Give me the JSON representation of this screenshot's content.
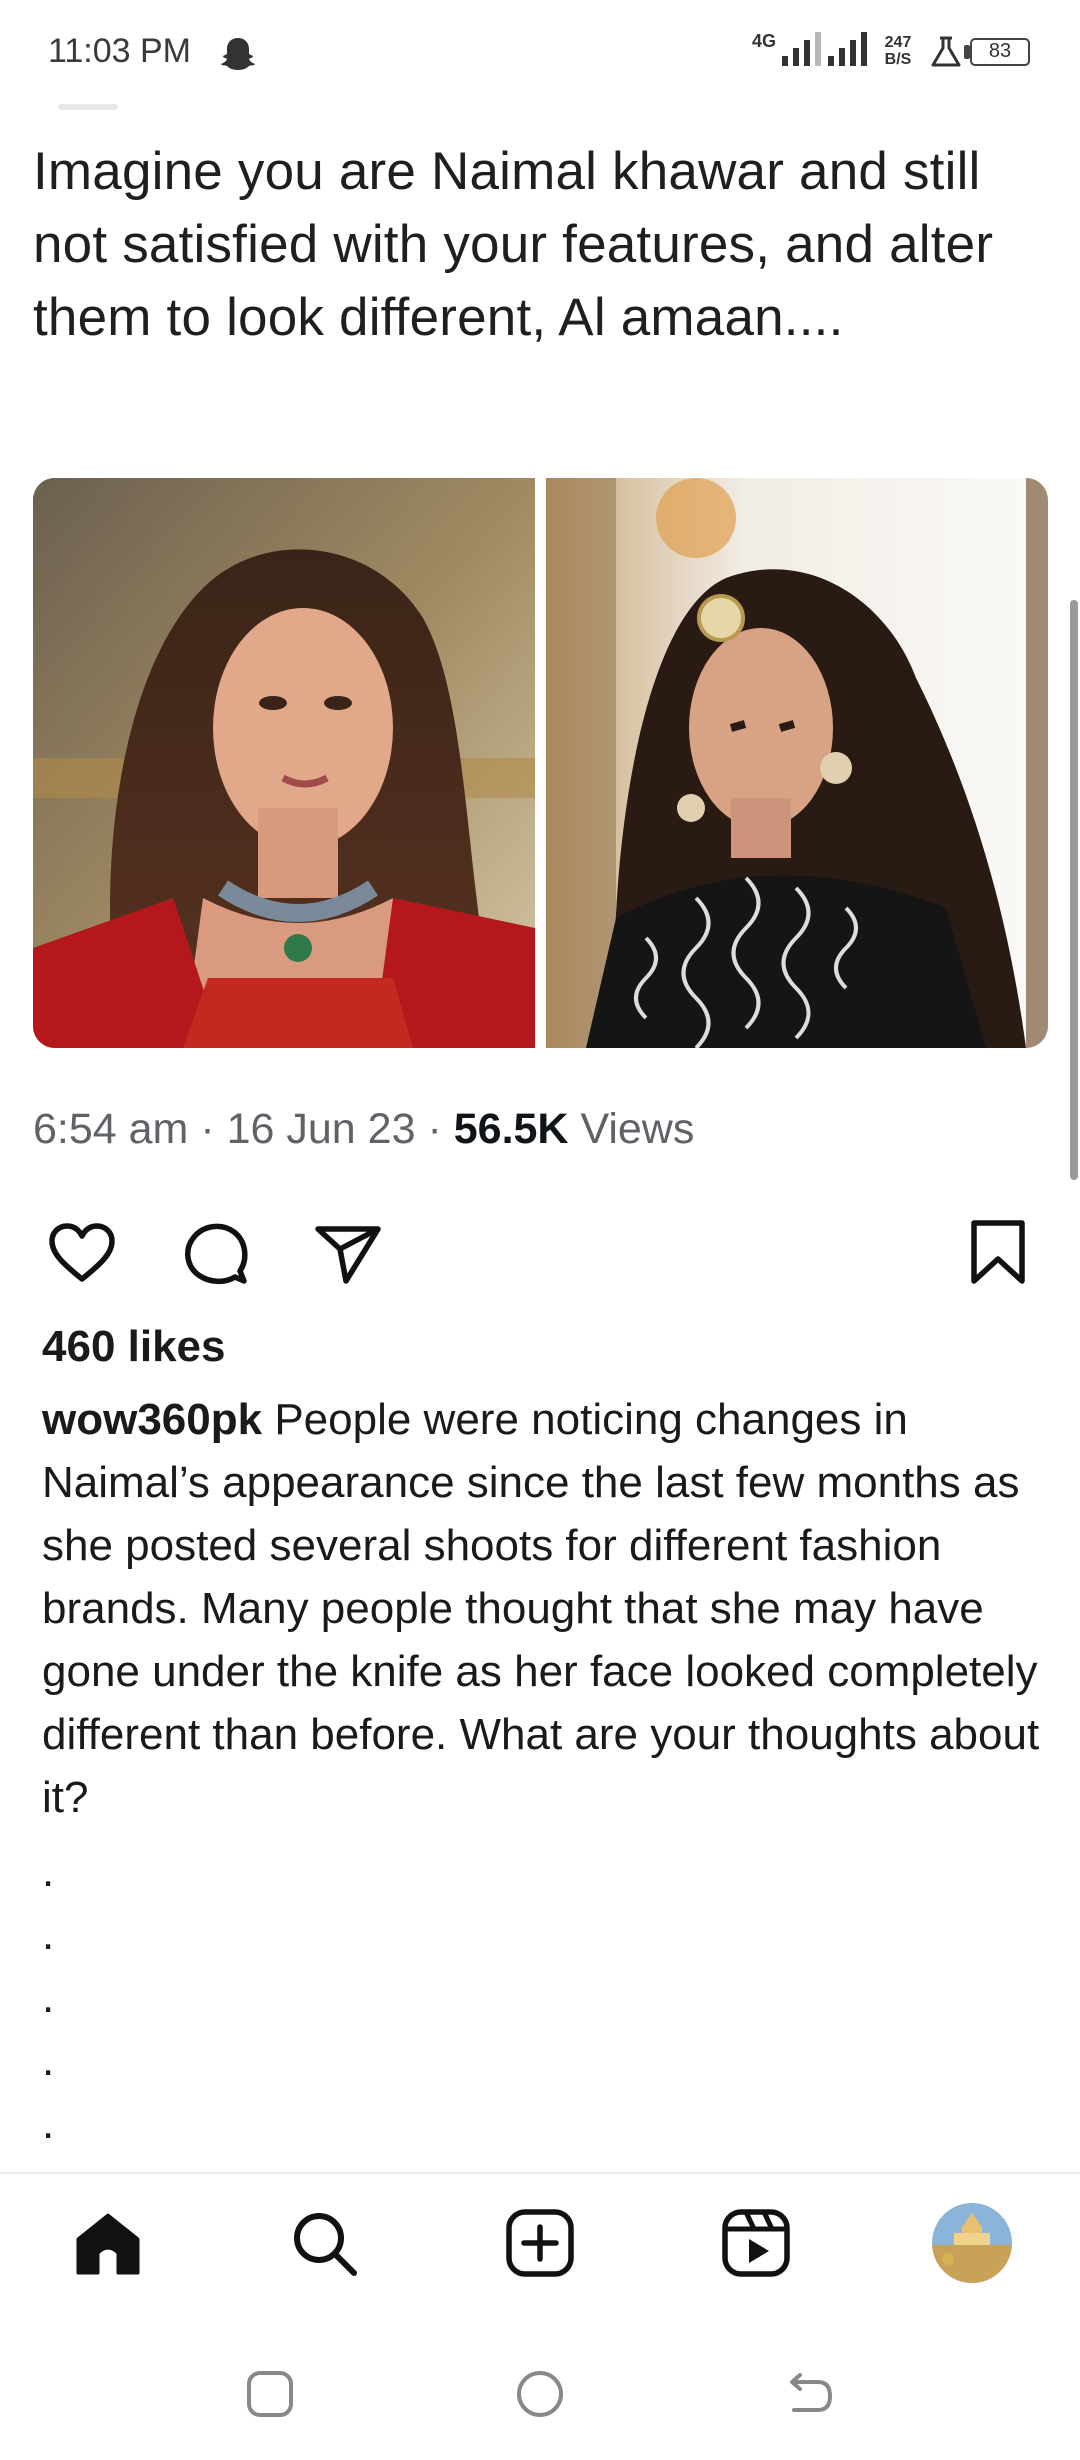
{
  "status_bar": {
    "time": "11:03 PM",
    "network_type": "4G",
    "data_speed_value": "247",
    "data_speed_unit": "B/S",
    "battery": "83",
    "icons": [
      "snapchat-icon",
      "signal-icon",
      "lab-icon",
      "battery-icon"
    ]
  },
  "tweet": {
    "text": "Imagine you are Naimal khawar and still not satisfied with your features, and alter them to look different, Al amaan....",
    "time": "6:54 am",
    "date": "16 Jun 23",
    "views_count": "56.5K",
    "views_label": "Views",
    "sep": "·"
  },
  "post": {
    "actions": [
      "heart-icon",
      "comment-icon",
      "share-icon",
      "bookmark-icon"
    ],
    "likes": "460 likes",
    "username": "wow360pk",
    "caption": "People were noticing changes in Naimal’s appearance since the last few months as she posted several shoots for different fashion brands. Many people thought that she may have gone under the knife as her face looked completely different than before. What are your thoughts about it?",
    "dots": [
      ".",
      ".",
      ".",
      ".",
      "."
    ]
  },
  "bottom_nav": {
    "items": [
      "home-icon",
      "search-icon",
      "create-icon",
      "reels-icon",
      "profile-avatar"
    ]
  },
  "system_nav": {
    "items": [
      "recents-button",
      "home-button",
      "back-button"
    ]
  },
  "colors": {
    "text": "#1a1a1a",
    "meta": "#5f6368",
    "divider": "#ececec"
  }
}
